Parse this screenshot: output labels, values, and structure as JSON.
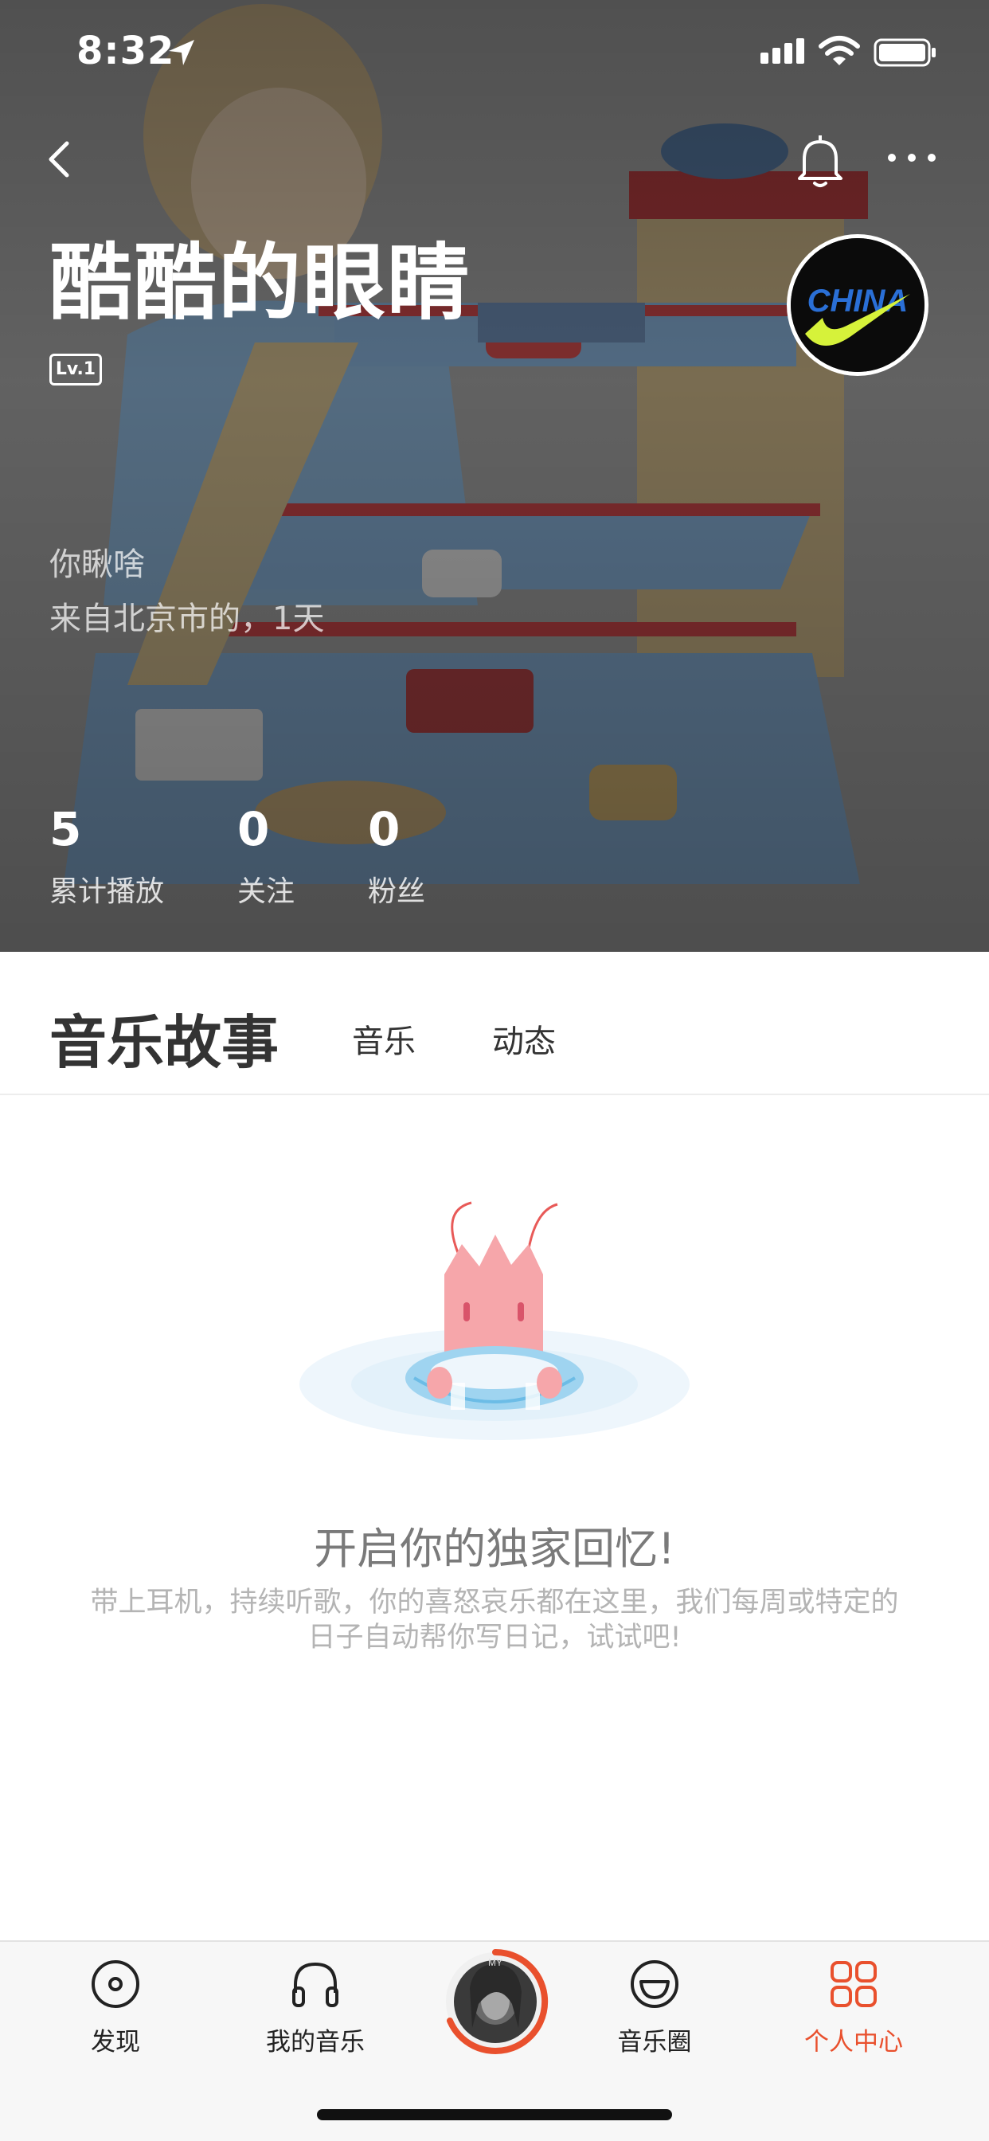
{
  "status_bar": {
    "time": "8:32"
  },
  "profile": {
    "name": "酷酷的眼睛",
    "level": "Lv.1",
    "avatar_text": "CHINA",
    "signature": "你瞅啥",
    "location": "来自北京市的，1天",
    "stats": [
      {
        "value": "5",
        "label": "累计播放"
      },
      {
        "value": "0",
        "label": "关注"
      },
      {
        "value": "0",
        "label": "粉丝"
      }
    ]
  },
  "tabs": {
    "active": "音乐故事",
    "items": [
      "音乐",
      "动态"
    ]
  },
  "empty_state": {
    "title": "开启你的独家回忆!",
    "description": "带上耳机，持续听歌，你的喜怒哀乐都在这里，我们每周或特定的日子自动帮你写日记，试试吧!"
  },
  "tabbar": {
    "items": [
      {
        "label": "发现",
        "icon": "disc-icon"
      },
      {
        "label": "我的音乐",
        "icon": "headphones-icon"
      },
      {
        "label": "音乐圈",
        "icon": "smile-icon"
      },
      {
        "label": "个人中心",
        "icon": "grid-icon"
      }
    ],
    "player_label": "MY",
    "active_index": 3
  },
  "colors": {
    "accent": "#e9502d",
    "text_primary": "#333333",
    "text_muted": "#b4b4b4"
  }
}
